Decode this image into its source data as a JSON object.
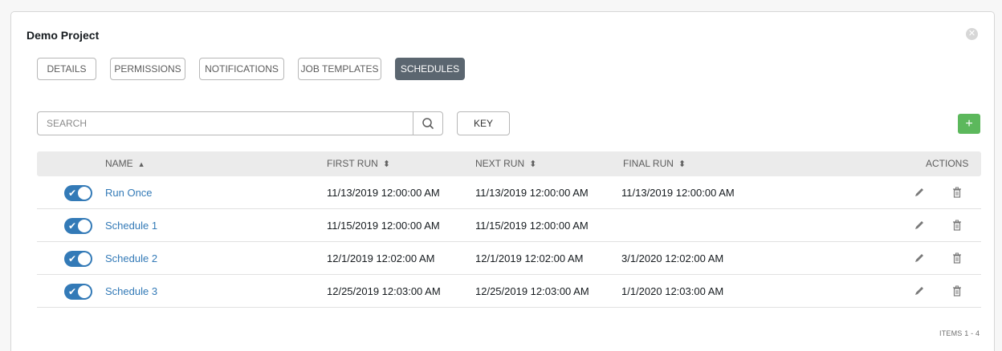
{
  "project": {
    "title": "Demo Project"
  },
  "tabs": [
    {
      "label": "DETAILS",
      "active": false
    },
    {
      "label": "PERMISSIONS",
      "active": false
    },
    {
      "label": "NOTIFICATIONS",
      "active": false
    },
    {
      "label": "JOB TEMPLATES",
      "active": false
    },
    {
      "label": "SCHEDULES",
      "active": true
    }
  ],
  "toolbar": {
    "search_placeholder": "SEARCH",
    "key_label": "KEY",
    "add_label": "+"
  },
  "table": {
    "columns": [
      {
        "label": "NAME",
        "sort": "asc"
      },
      {
        "label": "FIRST RUN",
        "sort": "both"
      },
      {
        "label": "NEXT RUN",
        "sort": "both"
      },
      {
        "label": "FINAL RUN",
        "sort": "both"
      },
      {
        "label": "ACTIONS",
        "sort": "none"
      }
    ],
    "rows": [
      {
        "enabled": true,
        "name": "Run Once",
        "first_run": "11/13/2019 12:00:00 AM",
        "next_run": "11/13/2019 12:00:00 AM",
        "final_run": "11/13/2019 12:00:00 AM"
      },
      {
        "enabled": true,
        "name": "Schedule 1",
        "first_run": "11/15/2019 12:00:00 AM",
        "next_run": "11/15/2019 12:00:00 AM",
        "final_run": ""
      },
      {
        "enabled": true,
        "name": "Schedule 2",
        "first_run": "12/1/2019 12:02:00 AM",
        "next_run": "12/1/2019 12:02:00 AM",
        "final_run": "3/1/2020 12:02:00 AM"
      },
      {
        "enabled": true,
        "name": "Schedule 3",
        "first_run": "12/25/2019 12:03:00 AM",
        "next_run": "12/25/2019 12:03:00 AM",
        "final_run": "1/1/2020 12:03:00 AM"
      }
    ]
  },
  "pagination": {
    "items_label": "ITEMS 1 - 4"
  },
  "colors": {
    "accent": "#337ab7",
    "active_tab": "#5b6670",
    "add_button": "#5cb85c"
  },
  "icons": {
    "close": "close-icon",
    "search": "search-icon",
    "edit": "pencil-icon",
    "delete": "trash-icon",
    "sort_asc": "sort-asc-icon",
    "sort_both": "sort-icon"
  }
}
